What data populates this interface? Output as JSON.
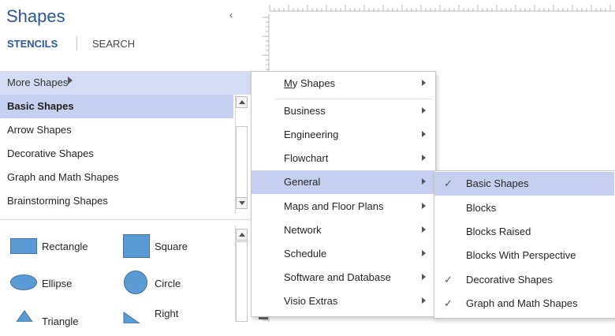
{
  "pane": {
    "title": "Shapes",
    "collapse_glyph": "‹",
    "tabs": {
      "stencils": "STENCILS",
      "search": "SEARCH"
    },
    "more_shapes": "More Shapes",
    "stencils": [
      {
        "label": "Basic Shapes",
        "selected": true
      },
      {
        "label": "Arrow Shapes",
        "selected": false
      },
      {
        "label": "Decorative Shapes",
        "selected": false
      },
      {
        "label": "Graph and Math Shapes",
        "selected": false
      },
      {
        "label": "Brainstorming Shapes",
        "selected": false
      }
    ],
    "shapes": {
      "rectangle": "Rectangle",
      "square": "Square",
      "ellipse": "Ellipse",
      "circle": "Circle",
      "triangle": "Triangle",
      "right": "Right"
    }
  },
  "menu": {
    "my_shapes_underline": "M",
    "my_shapes_rest": "y Shapes",
    "items": [
      {
        "label": "Business"
      },
      {
        "label": "Engineering"
      },
      {
        "label": "Flowchart"
      },
      {
        "label": "General",
        "highlighted": true
      },
      {
        "label": "Maps and Floor Plans"
      },
      {
        "label": "Network"
      },
      {
        "label": "Schedule"
      },
      {
        "label": "Software and Database"
      },
      {
        "label": "Visio Extras"
      }
    ]
  },
  "submenu": {
    "items": [
      {
        "label": "Basic Shapes",
        "checked": true,
        "highlighted": true
      },
      {
        "label": "Blocks",
        "checked": false
      },
      {
        "label": "Blocks Raised",
        "checked": false
      },
      {
        "label": "Blocks With Perspective",
        "checked": false
      },
      {
        "label": "Decorative Shapes",
        "checked": true
      },
      {
        "label": "Graph and Math Shapes",
        "checked": true
      }
    ],
    "check_glyph": "✓"
  },
  "colors": {
    "accent": "#2b579a",
    "highlight": "#c5d0f0",
    "shape_fill": "#5b9bd5"
  }
}
